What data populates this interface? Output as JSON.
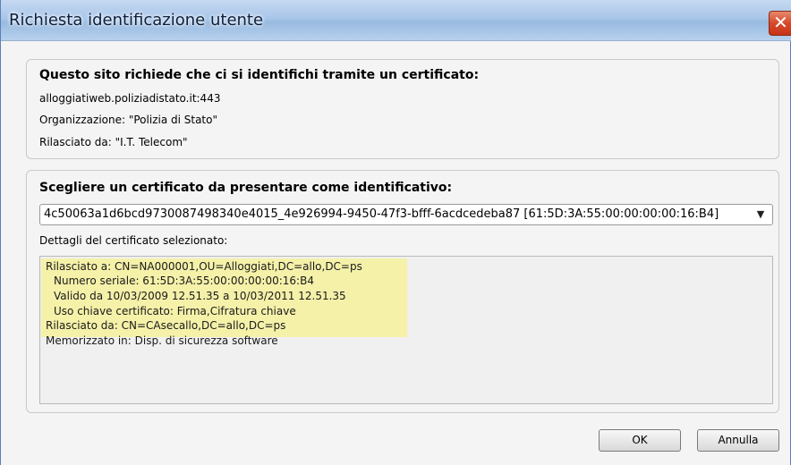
{
  "window": {
    "title": "Richiesta identificazione utente",
    "close_glyph": "✕"
  },
  "site_group": {
    "heading": "Questo sito richiede che ci si identifichi tramite un certificato:",
    "host": "alloggiatiweb.poliziadistato.it:443",
    "organization": "Organizzazione: \"Polizia di Stato\"",
    "issued_by": "Rilasciato da: \"I.T. Telecom\""
  },
  "cert_group": {
    "heading": "Scegliere un certificato da presentare come identificativo:",
    "selected_certificate": "4c50063a1d6bcd9730087498340e4015_4e926994-9450-47f3-bfff-6acdcedeba87 [61:5D:3A:55:00:00:00:00:16:B4]",
    "details_label": "Dettagli del certificato selezionato:",
    "details": {
      "issued_to": "Rilasciato a: CN=NA000001,OU=Alloggiati,DC=allo,DC=ps",
      "serial": "Numero seriale: 61:5D:3A:55:00:00:00:00:16:B4",
      "validity": "Valido da 10/03/2009 12.51.35 a 10/03/2011 12.51.35",
      "key_usage": "Uso chiave certificato: Firma,Cifratura chiave",
      "issued_by": "Rilasciato da: CN=CAsecallo,DC=allo,DC=ps",
      "stored_in": "Memorizzato in: Disp. di sicurezza software"
    }
  },
  "buttons": {
    "ok": "OK",
    "cancel": "Annulla"
  },
  "icons": {
    "close": "close-icon",
    "dropdown": "chevron-down-icon"
  },
  "colors": {
    "highlight": "#f5f1a9",
    "close_button": "#d6492a"
  }
}
